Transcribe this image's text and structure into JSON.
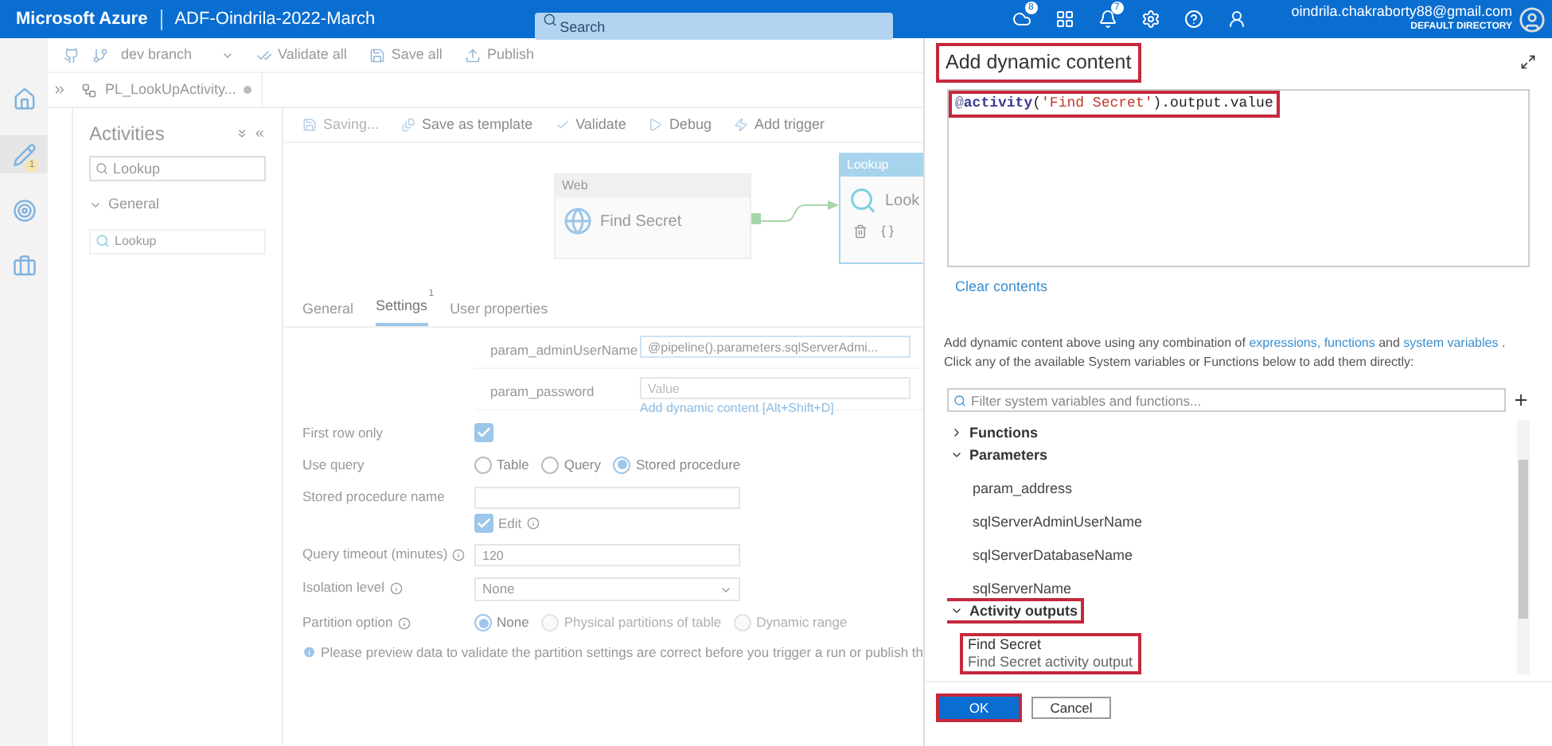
{
  "header": {
    "brand": "Microsoft Azure",
    "factory": "ADF-Oindrila-2022-March",
    "search": {
      "placeholder": "Search"
    },
    "icons": [
      {
        "kind": "cloud",
        "badge": "8"
      },
      {
        "kind": "grid"
      },
      {
        "kind": "bell",
        "badge": "7"
      },
      {
        "kind": "settings"
      },
      {
        "kind": "help"
      },
      {
        "kind": "person"
      }
    ],
    "user": {
      "email": "oindrila.chakraborty88@gmail.com",
      "directory": "DEFAULT DIRECTORY"
    }
  },
  "rail": [
    {
      "kind": "home",
      "selected": false
    },
    {
      "kind": "pencil",
      "selected": true,
      "badge": "1"
    },
    {
      "kind": "monitor",
      "selected": false
    },
    {
      "kind": "briefcase",
      "selected": false
    }
  ],
  "toolbar": {
    "branch": "dev branch",
    "actions": [
      {
        "kind": "validate",
        "label": "Validate all"
      },
      {
        "kind": "save",
        "label": "Save all"
      },
      {
        "kind": "publish",
        "label": "Publish"
      }
    ]
  },
  "pipeline_tab": {
    "label": "PL_LookUpActivity...",
    "unsaved": true
  },
  "activities": {
    "title": "Activities",
    "search": {
      "value": "Lookup"
    },
    "groups": [
      {
        "label": "General",
        "expanded": true,
        "items": [
          "Lookup"
        ]
      }
    ]
  },
  "canvas_toolbar": [
    {
      "kind": "save",
      "label": "Saving...",
      "disabled": true
    },
    {
      "kind": "template",
      "label": "Save as template",
      "disabled": false
    },
    {
      "kind": "validate",
      "label": "Validate",
      "disabled": false
    },
    {
      "kind": "debug",
      "label": "Debug",
      "disabled": false
    },
    {
      "kind": "trigger",
      "label": "Add trigger",
      "disabled": false
    }
  ],
  "nodes": [
    {
      "kind": "web",
      "type": "Web",
      "name": "Find Secret",
      "selected": false
    },
    {
      "kind": "lookup",
      "type": "Lookup",
      "name": "Look",
      "selected": true
    }
  ],
  "property_tabs": [
    {
      "label": "General",
      "selected": false
    },
    {
      "label": "Settings",
      "selected": true,
      "badge": "1"
    },
    {
      "label": "User properties",
      "selected": false
    }
  ],
  "parameters": [
    {
      "name": "param_adminUserName",
      "value": "@pipeline().parameters.sqlServerAdmi..."
    },
    {
      "name": "param_password",
      "placeholder": "Value",
      "link": "Add dynamic content [Alt+Shift+D]"
    }
  ],
  "settings": [
    {
      "kind": "checkbox",
      "label": "First row only",
      "checked": true
    },
    {
      "kind": "radio",
      "label": "Use query",
      "options": [
        {
          "label": "Table",
          "selected": false,
          "disabled": false
        },
        {
          "label": "Query",
          "selected": false,
          "disabled": false
        },
        {
          "label": "Stored procedure",
          "selected": true,
          "disabled": false
        }
      ]
    },
    {
      "kind": "text",
      "label": "Stored procedure name",
      "edit": {
        "label": "Edit",
        "checked": true
      }
    },
    {
      "kind": "text",
      "label": "Query timeout (minutes)",
      "info": true,
      "value": "120"
    },
    {
      "kind": "select",
      "label": "Isolation level",
      "info": true,
      "value": "None"
    },
    {
      "kind": "radio",
      "label": "Partition option",
      "info": true,
      "options": [
        {
          "label": "None",
          "selected": true,
          "disabled": false
        },
        {
          "label": "Physical partitions of table",
          "selected": false,
          "disabled": true
        },
        {
          "label": "Dynamic range",
          "selected": false,
          "disabled": true
        }
      ]
    }
  ],
  "notice": "Please preview data to validate the partition settings are correct before you trigger a run or publish th",
  "dialog": {
    "title": "Add dynamic content",
    "highlighted": true,
    "expression": {
      "highlighted": true,
      "tokens": [
        {
          "kind": "at",
          "text": "@"
        },
        {
          "kind": "function",
          "text": "activity"
        },
        {
          "kind": "plain",
          "text": "("
        },
        {
          "kind": "string",
          "text": "'Find Secret'"
        },
        {
          "kind": "plain",
          "text": ").output.value"
        }
      ]
    },
    "clear": "Clear contents",
    "help": [
      {
        "kind": "text",
        "text": "Add dynamic content above using any combination of "
      },
      {
        "kind": "link",
        "text": "expressions, functions"
      },
      {
        "kind": "text",
        "text": " and "
      },
      {
        "kind": "link",
        "text": "system variables"
      },
      {
        "kind": "text",
        "text": " ."
      }
    ],
    "help2": "Click any of the available System variables or Functions below to add them directly:",
    "filter": {
      "placeholder": "Filter system variables and functions..."
    },
    "tree": [
      {
        "label": "Functions",
        "expanded": false,
        "highlighted": false
      },
      {
        "label": "Parameters",
        "expanded": true,
        "highlighted": false,
        "children": [
          {
            "label": "param_address"
          },
          {
            "label": "sqlServerAdminUserName"
          },
          {
            "label": "sqlServerDatabaseName"
          },
          {
            "label": "sqlServerName"
          }
        ]
      },
      {
        "label": "Activity outputs",
        "expanded": true,
        "highlighted": true,
        "children": [
          {
            "label": "Find Secret",
            "subtitle": "Find Secret activity output",
            "highlighted": true
          }
        ]
      }
    ],
    "buttons": [
      {
        "label": "OK",
        "primary": true,
        "highlighted": true
      },
      {
        "label": "Cancel",
        "primary": false,
        "highlighted": false
      }
    ]
  }
}
